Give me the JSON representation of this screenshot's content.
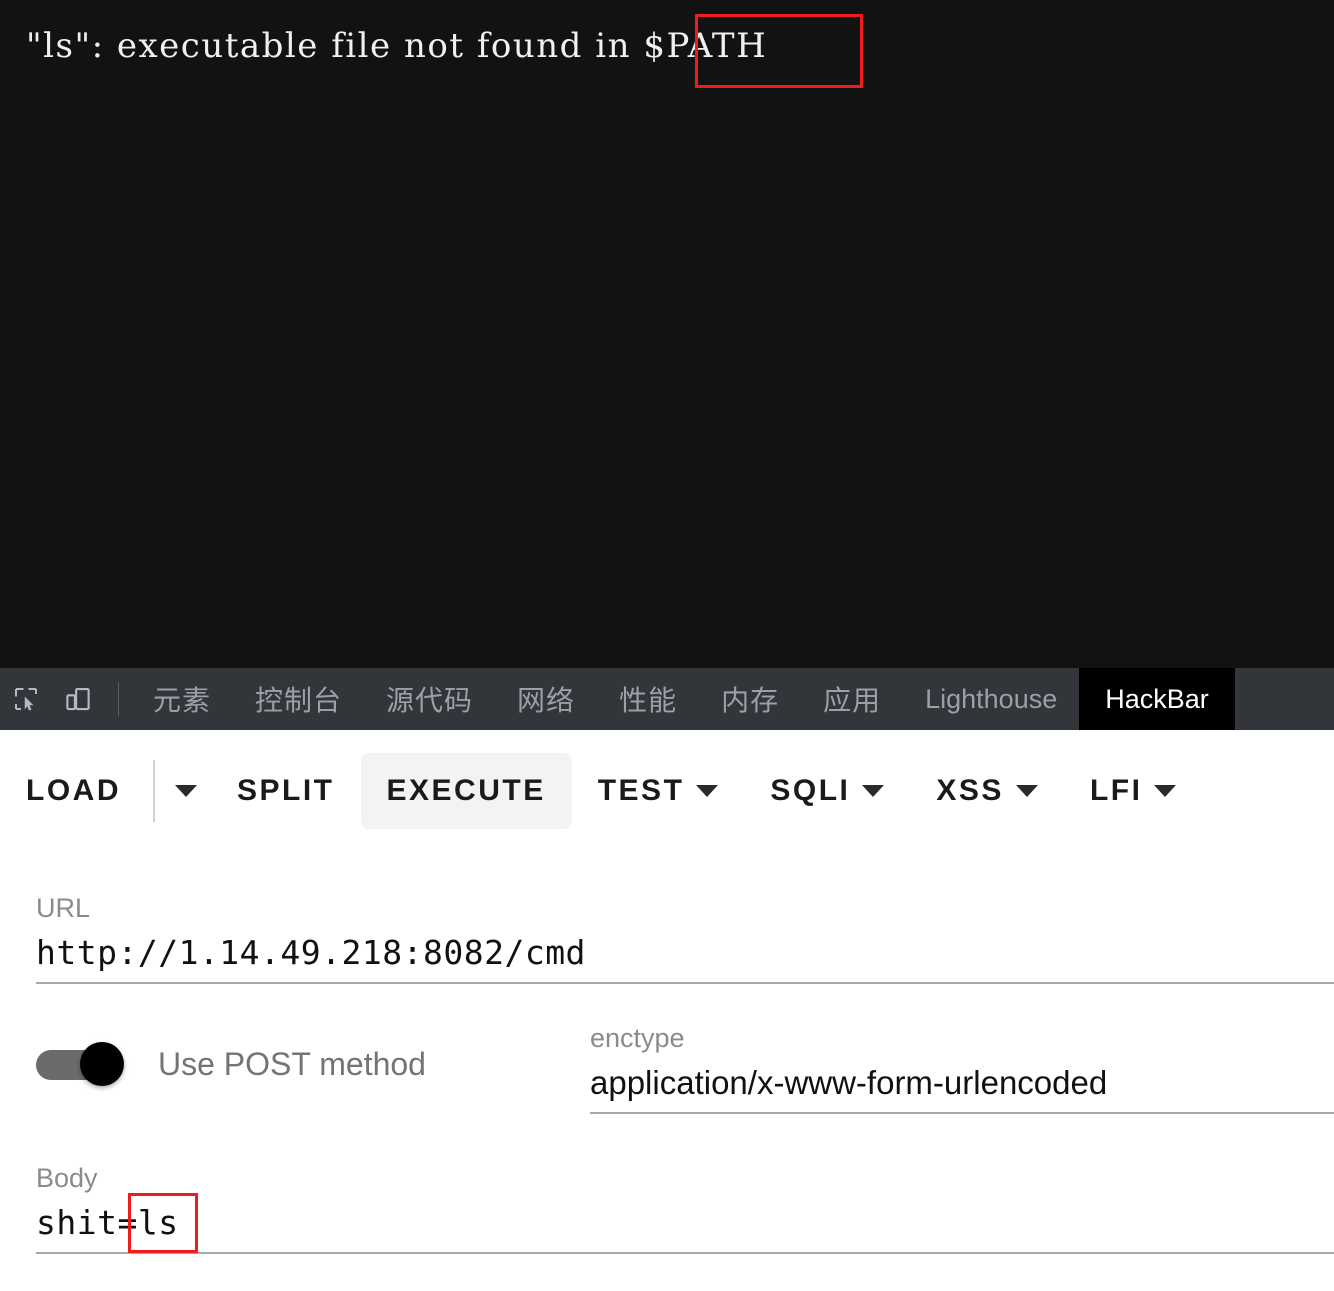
{
  "page_output": {
    "text": "\"ls\": executable file not found in $PATH",
    "background_color": "#121212",
    "text_color": "#f0f0f0",
    "annotation": {
      "target": "$PATH",
      "color": "#f01c1c"
    }
  },
  "devtools": {
    "icons": [
      {
        "name": "inspect-element-icon"
      },
      {
        "name": "device-toolbar-icon"
      }
    ],
    "tabs": [
      {
        "label": "元素",
        "cjk": true,
        "active": false
      },
      {
        "label": "控制台",
        "cjk": true,
        "active": false
      },
      {
        "label": "源代码",
        "cjk": true,
        "active": false
      },
      {
        "label": "网络",
        "cjk": true,
        "active": false
      },
      {
        "label": "性能",
        "cjk": true,
        "active": false
      },
      {
        "label": "内存",
        "cjk": true,
        "active": false
      },
      {
        "label": "应用",
        "cjk": true,
        "active": false
      },
      {
        "label": "Lighthouse",
        "cjk": false,
        "active": false
      },
      {
        "label": "HackBar",
        "cjk": false,
        "active": true
      }
    ],
    "tabbar_background": "#323539",
    "active_tab_background": "#000000"
  },
  "hackbar": {
    "toolbar": {
      "load_label": "LOAD",
      "split_label": "SPLIT",
      "execute_label": "EXECUTE",
      "test_label": "TEST",
      "sqli_label": "SQLI",
      "xss_label": "XSS",
      "lfi_label": "LFI",
      "active_button": "EXECUTE",
      "active_background": "#f3f3f3"
    },
    "fields": {
      "url": {
        "label": "URL",
        "value": "http://1.14.49.218:8082/cmd"
      },
      "enctype": {
        "label": "enctype",
        "value": "application/x-www-form-urlencoded"
      },
      "body": {
        "label": "Body",
        "value": "shit=ls",
        "annotation": {
          "target": "=ls",
          "color": "#f01c1c"
        }
      }
    },
    "post_toggle": {
      "label": "Use POST method",
      "checked": true
    }
  }
}
